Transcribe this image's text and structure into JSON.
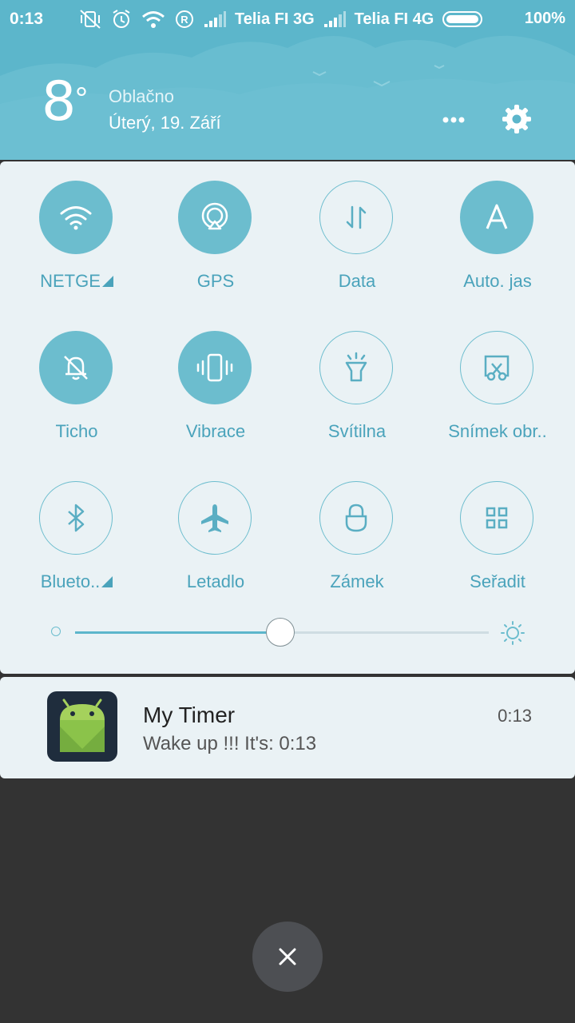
{
  "status_bar": {
    "time": "0:13",
    "carrier_1": "Telia FI 3G",
    "carrier_2": "Telia FI 4G",
    "battery": "100%"
  },
  "weather": {
    "temperature": "8",
    "unit": "°",
    "condition": "Oblačno",
    "date": "Úterý, 19. Září"
  },
  "quick_settings": {
    "tiles": [
      {
        "label": "NETGE",
        "icon": "wifi-icon",
        "on": true
      },
      {
        "label": "GPS",
        "icon": "location-icon",
        "on": true
      },
      {
        "label": "Data",
        "icon": "data-arrows-icon",
        "on": false
      },
      {
        "label": "Auto. jas",
        "icon": "auto-brightness-icon",
        "on": true
      },
      {
        "label": "Ticho",
        "icon": "silent-bell-icon",
        "on": true
      },
      {
        "label": "Vibrace",
        "icon": "vibrate-icon",
        "on": true
      },
      {
        "label": "Svítilna",
        "icon": "flashlight-icon",
        "on": false
      },
      {
        "label": "Snímek obr..",
        "icon": "screenshot-icon",
        "on": false
      },
      {
        "label": "Blueto..",
        "icon": "bluetooth-icon",
        "on": false
      },
      {
        "label": "Letadlo",
        "icon": "airplane-icon",
        "on": false
      },
      {
        "label": "Zámek",
        "icon": "lock-icon",
        "on": false
      },
      {
        "label": "Seřadit",
        "icon": "grid-icon",
        "on": false
      }
    ],
    "brightness_level": 0.496
  },
  "notification": {
    "app_title": "My Timer",
    "text": "Wake up !!! It's: 0:13",
    "time": "0:13"
  },
  "colors": {
    "accent": "#5cb6cb",
    "tile_on": "#6cbdce",
    "panel_bg": "#eaf2f5",
    "scrim": "#333333"
  }
}
